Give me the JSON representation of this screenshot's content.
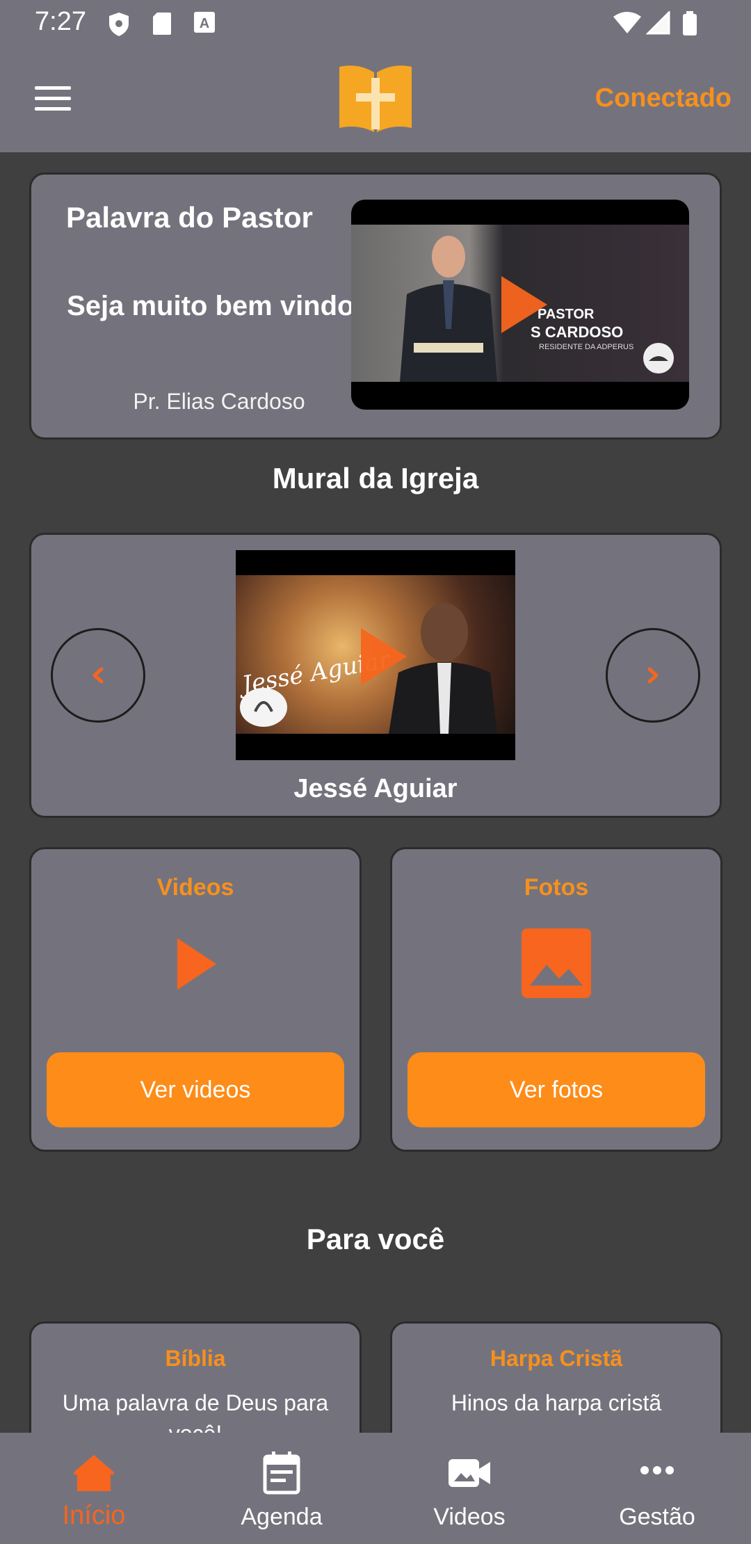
{
  "status_bar": {
    "time": "7:27"
  },
  "header": {
    "status": "Conectado"
  },
  "pastor_card": {
    "title": "Palavra do Pastor",
    "welcome": "Seja muito bem vindo !",
    "author": "Pr. Elias Cardoso",
    "video": {
      "line1": "PASTOR",
      "line2": "S CARDOSO",
      "line3": "RESIDENTE DA ADPERUS"
    }
  },
  "mural": {
    "title": "Mural da Igreja",
    "video_art_text": "Jessé Aguiar",
    "caption": "Jessé Aguiar"
  },
  "features": [
    {
      "title": "Videos",
      "button": "Ver videos",
      "icon": "play-icon"
    },
    {
      "title": "Fotos",
      "button": "Ver fotos",
      "icon": "image-icon"
    }
  ],
  "para_voce": {
    "title": "Para você",
    "cards": [
      {
        "title": "Bíblia",
        "description": "Uma palavra de Deus para você!"
      },
      {
        "title": "Harpa Cristã",
        "description": "Hinos da harpa cristã"
      }
    ]
  },
  "bottom_nav": [
    {
      "label": "Início",
      "icon": "home-icon",
      "active": true
    },
    {
      "label": "Agenda",
      "icon": "calendar-icon",
      "active": false
    },
    {
      "label": "Videos",
      "icon": "video-camera-icon",
      "active": false
    },
    {
      "label": "Gestão",
      "icon": "more-horizontal-icon",
      "active": false
    }
  ],
  "colors": {
    "accent": "#f7901e",
    "button": "#fd8c19",
    "surface": "#74737d",
    "background": "#404040"
  }
}
